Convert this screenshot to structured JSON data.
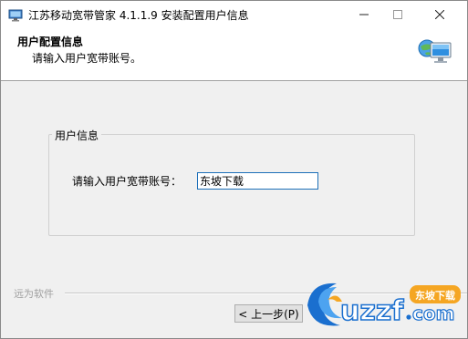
{
  "window": {
    "title": "江苏移动宽带管家 4.1.1.9 安装配置用户信息"
  },
  "header": {
    "title": "用户配置信息",
    "subtitle": "请输入用户宽带账号。"
  },
  "group": {
    "legend": "用户信息",
    "account_label": "请输入用户宽带账号：",
    "account_value": "东坡下载"
  },
  "footer": {
    "brand": "远为软件",
    "back_label": "< 上一步(P)"
  },
  "watermark": {
    "brand_text": "uzzf.com",
    "badge_text": "东坡下载"
  },
  "colors": {
    "accent": "#1c6fb8",
    "watermark_blue": "#1a6fcf",
    "watermark_orange": "#f5a623"
  }
}
